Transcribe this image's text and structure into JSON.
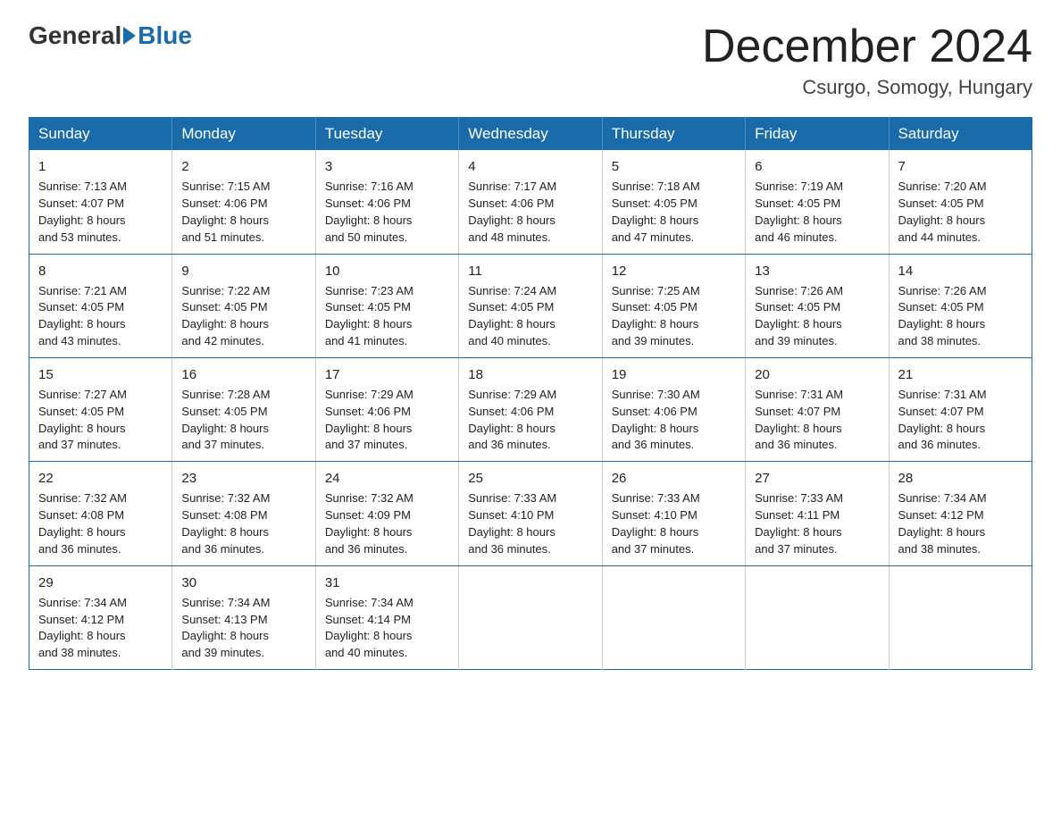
{
  "logo": {
    "general": "General",
    "arrow_color": "#1a6baa",
    "blue": "Blue"
  },
  "header": {
    "title": "December 2024",
    "location": "Csurgo, Somogy, Hungary"
  },
  "weekdays": [
    "Sunday",
    "Monday",
    "Tuesday",
    "Wednesday",
    "Thursday",
    "Friday",
    "Saturday"
  ],
  "weeks": [
    [
      {
        "day": "1",
        "sunrise": "7:13 AM",
        "sunset": "4:07 PM",
        "daylight": "8 hours and 53 minutes."
      },
      {
        "day": "2",
        "sunrise": "7:15 AM",
        "sunset": "4:06 PM",
        "daylight": "8 hours and 51 minutes."
      },
      {
        "day": "3",
        "sunrise": "7:16 AM",
        "sunset": "4:06 PM",
        "daylight": "8 hours and 50 minutes."
      },
      {
        "day": "4",
        "sunrise": "7:17 AM",
        "sunset": "4:06 PM",
        "daylight": "8 hours and 48 minutes."
      },
      {
        "day": "5",
        "sunrise": "7:18 AM",
        "sunset": "4:05 PM",
        "daylight": "8 hours and 47 minutes."
      },
      {
        "day": "6",
        "sunrise": "7:19 AM",
        "sunset": "4:05 PM",
        "daylight": "8 hours and 46 minutes."
      },
      {
        "day": "7",
        "sunrise": "7:20 AM",
        "sunset": "4:05 PM",
        "daylight": "8 hours and 44 minutes."
      }
    ],
    [
      {
        "day": "8",
        "sunrise": "7:21 AM",
        "sunset": "4:05 PM",
        "daylight": "8 hours and 43 minutes."
      },
      {
        "day": "9",
        "sunrise": "7:22 AM",
        "sunset": "4:05 PM",
        "daylight": "8 hours and 42 minutes."
      },
      {
        "day": "10",
        "sunrise": "7:23 AM",
        "sunset": "4:05 PM",
        "daylight": "8 hours and 41 minutes."
      },
      {
        "day": "11",
        "sunrise": "7:24 AM",
        "sunset": "4:05 PM",
        "daylight": "8 hours and 40 minutes."
      },
      {
        "day": "12",
        "sunrise": "7:25 AM",
        "sunset": "4:05 PM",
        "daylight": "8 hours and 39 minutes."
      },
      {
        "day": "13",
        "sunrise": "7:26 AM",
        "sunset": "4:05 PM",
        "daylight": "8 hours and 39 minutes."
      },
      {
        "day": "14",
        "sunrise": "7:26 AM",
        "sunset": "4:05 PM",
        "daylight": "8 hours and 38 minutes."
      }
    ],
    [
      {
        "day": "15",
        "sunrise": "7:27 AM",
        "sunset": "4:05 PM",
        "daylight": "8 hours and 37 minutes."
      },
      {
        "day": "16",
        "sunrise": "7:28 AM",
        "sunset": "4:05 PM",
        "daylight": "8 hours and 37 minutes."
      },
      {
        "day": "17",
        "sunrise": "7:29 AM",
        "sunset": "4:06 PM",
        "daylight": "8 hours and 37 minutes."
      },
      {
        "day": "18",
        "sunrise": "7:29 AM",
        "sunset": "4:06 PM",
        "daylight": "8 hours and 36 minutes."
      },
      {
        "day": "19",
        "sunrise": "7:30 AM",
        "sunset": "4:06 PM",
        "daylight": "8 hours and 36 minutes."
      },
      {
        "day": "20",
        "sunrise": "7:31 AM",
        "sunset": "4:07 PM",
        "daylight": "8 hours and 36 minutes."
      },
      {
        "day": "21",
        "sunrise": "7:31 AM",
        "sunset": "4:07 PM",
        "daylight": "8 hours and 36 minutes."
      }
    ],
    [
      {
        "day": "22",
        "sunrise": "7:32 AM",
        "sunset": "4:08 PM",
        "daylight": "8 hours and 36 minutes."
      },
      {
        "day": "23",
        "sunrise": "7:32 AM",
        "sunset": "4:08 PM",
        "daylight": "8 hours and 36 minutes."
      },
      {
        "day": "24",
        "sunrise": "7:32 AM",
        "sunset": "4:09 PM",
        "daylight": "8 hours and 36 minutes."
      },
      {
        "day": "25",
        "sunrise": "7:33 AM",
        "sunset": "4:10 PM",
        "daylight": "8 hours and 36 minutes."
      },
      {
        "day": "26",
        "sunrise": "7:33 AM",
        "sunset": "4:10 PM",
        "daylight": "8 hours and 37 minutes."
      },
      {
        "day": "27",
        "sunrise": "7:33 AM",
        "sunset": "4:11 PM",
        "daylight": "8 hours and 37 minutes."
      },
      {
        "day": "28",
        "sunrise": "7:34 AM",
        "sunset": "4:12 PM",
        "daylight": "8 hours and 38 minutes."
      }
    ],
    [
      {
        "day": "29",
        "sunrise": "7:34 AM",
        "sunset": "4:12 PM",
        "daylight": "8 hours and 38 minutes."
      },
      {
        "day": "30",
        "sunrise": "7:34 AM",
        "sunset": "4:13 PM",
        "daylight": "8 hours and 39 minutes."
      },
      {
        "day": "31",
        "sunrise": "7:34 AM",
        "sunset": "4:14 PM",
        "daylight": "8 hours and 40 minutes."
      },
      null,
      null,
      null,
      null
    ]
  ],
  "labels": {
    "sunrise": "Sunrise:",
    "sunset": "Sunset:",
    "daylight": "Daylight:"
  }
}
